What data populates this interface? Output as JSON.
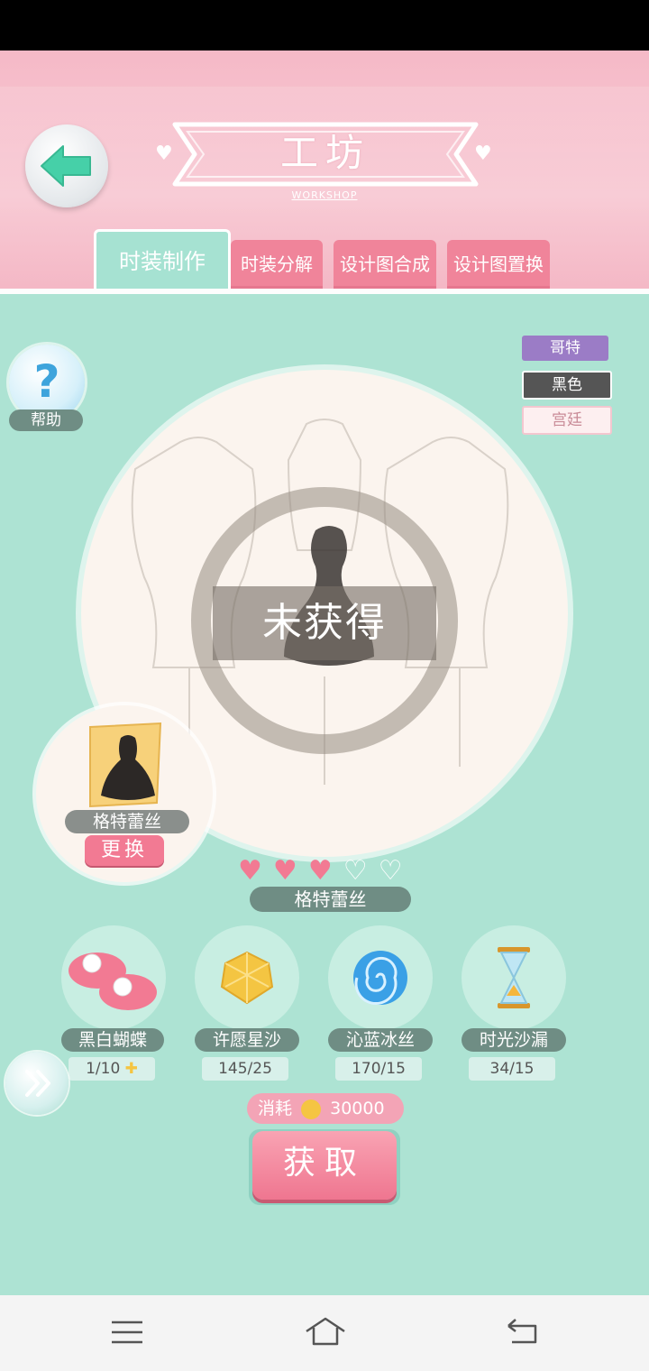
{
  "header": {
    "title": "工坊",
    "subtitle": "WORKSHOP"
  },
  "tabs": [
    {
      "label": "时装制作",
      "active": true
    },
    {
      "label": "时装分解",
      "active": false
    },
    {
      "label": "设计图合成",
      "active": false
    },
    {
      "label": "设计图置换",
      "active": false
    }
  ],
  "help": {
    "label": "帮助"
  },
  "style_tags": [
    {
      "label": "哥特",
      "bg": "#9b7cc6",
      "color": "#ffffff"
    },
    {
      "label": "黑色",
      "bg": "#555555",
      "color": "#ffffff"
    },
    {
      "label": "宫廷",
      "bg": "#fdeff0",
      "color": "#c98b97"
    }
  ],
  "preview": {
    "status": "未获得"
  },
  "design": {
    "name": "格特蕾丝",
    "swap_label": "更换"
  },
  "item": {
    "rating": 3,
    "rating_max": 5,
    "name": "格特蕾丝"
  },
  "materials": [
    {
      "name": "黑白蝴蝶",
      "count": "1/10",
      "icon": "bow-shoes-icon",
      "addable": true
    },
    {
      "name": "许愿星沙",
      "count": "145/25",
      "icon": "gold-gem-icon",
      "addable": false
    },
    {
      "name": "沁蓝冰丝",
      "count": "170/15",
      "icon": "blue-swirl-icon",
      "addable": false
    },
    {
      "name": "时光沙漏",
      "count": "34/15",
      "icon": "hourglass-icon",
      "addable": false
    }
  ],
  "cost": {
    "label": "消耗",
    "amount": "30000"
  },
  "action": {
    "label": "获取"
  },
  "colors": {
    "background": "#ade3d3",
    "header_pink": "#f5b9c7",
    "tab_pink": "#f0849a",
    "button_pink": "#f27a93"
  }
}
